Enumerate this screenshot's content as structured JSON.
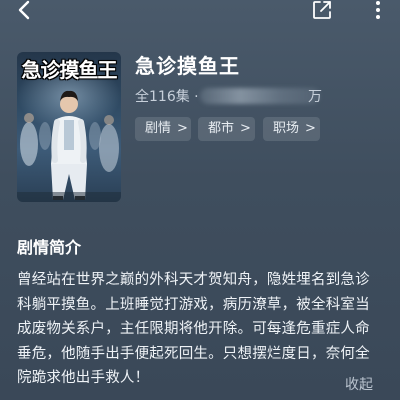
{
  "header": {
    "back_icon": "chevron-left-icon",
    "share_icon": "share-icon",
    "more_icon": "more-vertical-icon"
  },
  "poster": {
    "title_text": "急诊摸鱼王",
    "badge_icon": "bookmark-icon"
  },
  "drama": {
    "title": "急诊摸鱼王",
    "episodes": "全116集 · ",
    "meta_tail": "万"
  },
  "tags": [
    {
      "label": "剧情"
    },
    {
      "label": "都市"
    },
    {
      "label": "职场"
    }
  ],
  "synopsis": {
    "heading": "剧情简介",
    "lines": [
      "曾经站在世界之巅的外科天才贺知舟，隐姓埋名到急诊",
      "科躺平摸鱼。上班睡觉打游戏，病历潦草，被全科室当",
      "成废物关系户，主任限期将他开除。可每逢危重症人命",
      "垂危，他随手出手便起死回生。只想摆烂度日，奈何全",
      "院跪求他出手救人！"
    ],
    "collapse_label": "收起"
  },
  "colors": {
    "background": "#44535f",
    "text": "#ffffff",
    "muted": "#c7d0da",
    "tag_bg": "rgba(255,255,255,0.12)"
  }
}
